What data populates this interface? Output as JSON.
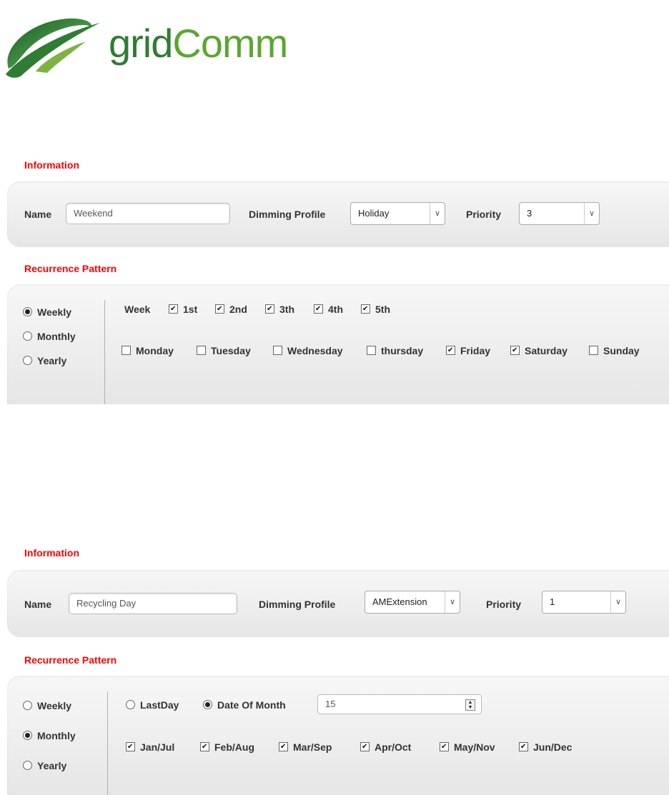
{
  "logo": {
    "text_part1": "grid",
    "text_part2": "Comm"
  },
  "form1": {
    "info_title": "Information",
    "name_label": "Name",
    "name_value": "Weekend",
    "dimming_label": "Dimming Profile",
    "dimming_value": "Holiday",
    "priority_label": "Priority",
    "priority_value": "3",
    "recurrence_title": "Recurrence Pattern",
    "patterns": [
      {
        "label": "Weekly",
        "selected": true
      },
      {
        "label": "Monthly",
        "selected": false
      },
      {
        "label": "Yearly",
        "selected": false
      }
    ],
    "week_label": "Week",
    "weeks": [
      {
        "label": "1st",
        "checked": true
      },
      {
        "label": "2nd",
        "checked": true
      },
      {
        "label": "3th",
        "checked": true
      },
      {
        "label": "4th",
        "checked": true
      },
      {
        "label": "5th",
        "checked": true
      }
    ],
    "days": [
      {
        "label": "Monday",
        "checked": false
      },
      {
        "label": "Tuesday",
        "checked": false
      },
      {
        "label": "Wednesday",
        "checked": false
      },
      {
        "label": "thursday",
        "checked": false
      },
      {
        "label": "Friday",
        "checked": true
      },
      {
        "label": "Saturday",
        "checked": true
      },
      {
        "label": "Sunday",
        "checked": false
      }
    ]
  },
  "form2": {
    "info_title": "Information",
    "name_label": "Name",
    "name_value": "Recycling Day",
    "dimming_label": "Dimming Profile",
    "dimming_value": "AMExtension",
    "priority_label": "Priority",
    "priority_value": "1",
    "recurrence_title": "Recurrence Pattern",
    "patterns": [
      {
        "label": "Weekly",
        "selected": false
      },
      {
        "label": "Monthly",
        "selected": true
      },
      {
        "label": "Yearly",
        "selected": false
      }
    ],
    "lastday_label": "LastDay",
    "lastday_selected": false,
    "date_of_month_label": "Date Of Month",
    "date_of_month_selected": true,
    "date_of_month_value": "15",
    "months": [
      {
        "label": "Jan/Jul",
        "checked": true
      },
      {
        "label": "Feb/Aug",
        "checked": true
      },
      {
        "label": "Mar/Sep",
        "checked": true
      },
      {
        "label": "Apr/Oct",
        "checked": true
      },
      {
        "label": "May/Nov",
        "checked": true
      },
      {
        "label": "Jun/Dec",
        "checked": true
      }
    ]
  },
  "colors": {
    "section_title": "#ff0000",
    "logo_dark": "#2e7d32",
    "logo_light": "#5aa62f"
  }
}
